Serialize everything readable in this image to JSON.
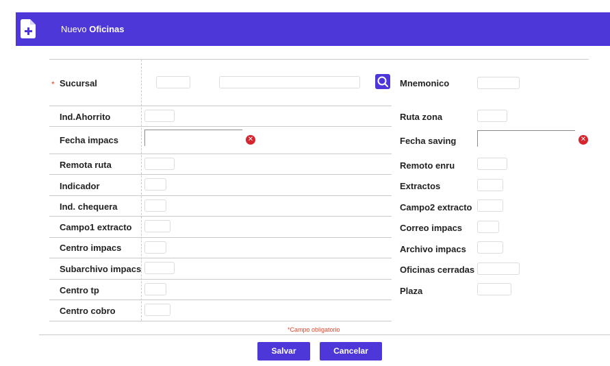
{
  "header": {
    "title_prefix": "Nuevo",
    "title_strong": "Oficinas",
    "icon": "file-plus-icon"
  },
  "form": {
    "sucursal": {
      "label": "Sucursal",
      "required_mark": "*"
    },
    "mnemonico": {
      "label": "Mnemonico"
    },
    "left_labels": [
      "Ind.Ahorrito",
      "Fecha impacs",
      "Remota ruta",
      "Indicador",
      "Ind. chequera",
      "Campo1 extracto",
      "Centro impacs",
      "Subarchivo impacs",
      "Centro tp",
      "Centro cobro"
    ],
    "right_labels": [
      "Ruta zona",
      "Fecha saving",
      "Remoto enru",
      "Extractos",
      "Campo2 extracto",
      "Correo impacs",
      "Archivo impacs",
      "Oficinas cerradas",
      "Plaza"
    ],
    "required_note": "*Campo obligatorio"
  },
  "buttons": {
    "save": "Salvar",
    "cancel": "Cancelar"
  },
  "colors": {
    "accent": "#4d37d9",
    "required": "#e0452b",
    "clear": "#d8242c"
  }
}
